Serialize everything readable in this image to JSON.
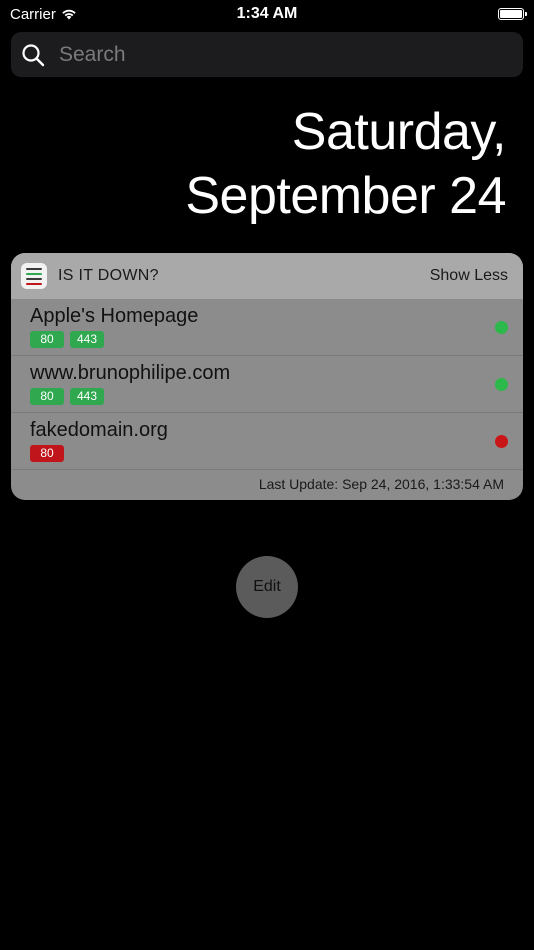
{
  "status_bar": {
    "carrier": "Carrier",
    "time": "1:34 AM",
    "battery_level": 1.0
  },
  "search": {
    "placeholder": "Search"
  },
  "date": {
    "line1": "Saturday,",
    "line2": "September 24"
  },
  "widget": {
    "app_name": "IS IT DOWN?",
    "toggle_label": "Show Less",
    "sites": [
      {
        "name": "Apple's Homepage",
        "ports": [
          "80",
          "443"
        ],
        "status": "up"
      },
      {
        "name": "www.brunophilipe.com",
        "ports": [
          "80",
          "443"
        ],
        "status": "up"
      },
      {
        "name": "fakedomain.org",
        "ports": [
          "80"
        ],
        "status": "down"
      }
    ],
    "last_update": "Last Update: Sep 24, 2016, 1:33:54 AM"
  },
  "edit_label": "Edit",
  "colors": {
    "up": "#2fa84f",
    "down": "#c0161b",
    "up_dot": "#2db84c",
    "down_dot": "#c91518"
  },
  "icons": {
    "wifi": "wifi-icon",
    "battery": "battery-icon",
    "search": "search-icon",
    "app": "list-icon"
  }
}
